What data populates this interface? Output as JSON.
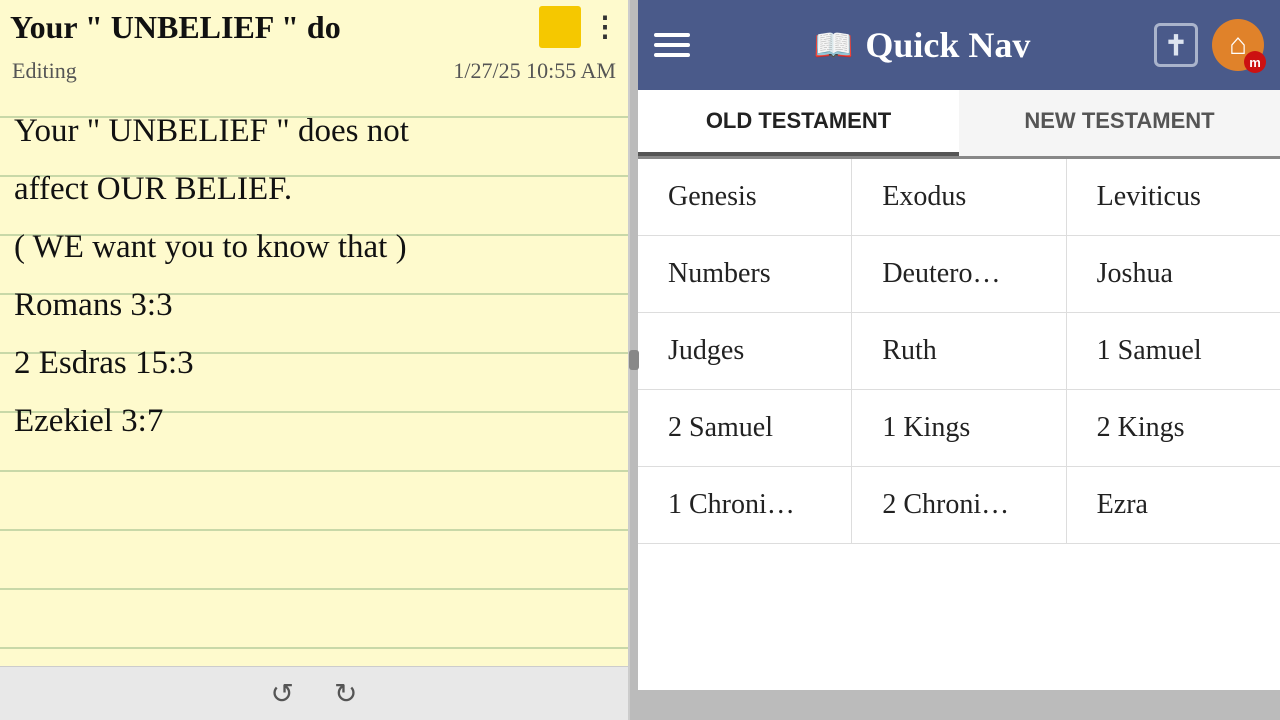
{
  "left": {
    "title": "Your \" UNBELIEF \" do",
    "yellow_square": "yellow",
    "dots_label": "⋮",
    "editing_label": "Editing",
    "timestamp": "1/27/25 10:55 AM",
    "note_lines": [
      "Your \" UNBELIEF \" does not",
      "affect OUR BELIEF.",
      "( WE want you to know that )",
      "Romans 3:3",
      "2 Esdras 15:3",
      "Ezekiel 3:7"
    ],
    "undo_icon": "↺",
    "redo_icon": "↻"
  },
  "right": {
    "header": {
      "title": "Quick Nav",
      "menu_icon": "hamburger",
      "book_icon": "📖",
      "cross_symbol": "✝",
      "home_symbol": "⌂",
      "m_badge": "m"
    },
    "tabs": [
      {
        "label": "OLD TESTAMENT",
        "active": true
      },
      {
        "label": "NEW TESTAMENT",
        "active": false
      }
    ],
    "books": [
      [
        "Genesis",
        "Exodus",
        "Leviticus"
      ],
      [
        "Numbers",
        "Deutero…",
        "Joshua"
      ],
      [
        "Judges",
        "Ruth",
        "1 Samuel"
      ],
      [
        "2 Samuel",
        "1 Kings",
        "2 Kings"
      ],
      [
        "1 Chroni…",
        "2 Chroni…",
        "Ezra"
      ]
    ]
  }
}
